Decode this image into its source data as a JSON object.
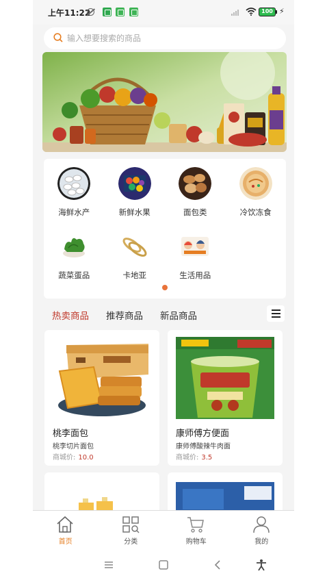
{
  "status_bar": {
    "time": "上午11:22",
    "battery": "100"
  },
  "search": {
    "placeholder": "输入想要搜索的商品",
    "value": ""
  },
  "banner": {
    "icons": [
      "grocery-basket-icon",
      "oil-bottle-icon",
      "noodle-bucket-icon"
    ]
  },
  "categories": [
    {
      "label": "海鲜水产",
      "icon": "dumplings-icon"
    },
    {
      "label": "新鲜水果",
      "icon": "fruit-box-icon"
    },
    {
      "label": "面包类",
      "icon": "bread-icon"
    },
    {
      "label": "冷饮冻食",
      "icon": "frozen-food-icon"
    },
    {
      "label": "蔬菜蛋品",
      "icon": "vegetable-icon"
    },
    {
      "label": "卡地亚",
      "icon": "bracelet-icon"
    },
    {
      "label": "生活用品",
      "icon": "daily-goods-icon"
    }
  ],
  "pager": {
    "pages": 1,
    "active": 0
  },
  "tabs": [
    {
      "label": "热卖商品",
      "active": true
    },
    {
      "label": "推荐商品",
      "active": false
    },
    {
      "label": "新品商品",
      "active": false
    }
  ],
  "products": [
    {
      "name": "桃李面包",
      "desc": "桃李切片面包",
      "price_label": "商城价:",
      "price": "10.0"
    },
    {
      "name": "康师傅方便面",
      "desc": "康师傅酸辣牛肉面",
      "price_label": "商城价:",
      "price": "3.5"
    }
  ],
  "bottom_nav": [
    {
      "label": "首页",
      "icon": "home-icon",
      "active": true
    },
    {
      "label": "分类",
      "icon": "category-grid-icon",
      "active": false
    },
    {
      "label": "购物车",
      "icon": "cart-icon",
      "active": false
    },
    {
      "label": "我的",
      "icon": "user-icon",
      "active": false
    }
  ],
  "colors": {
    "accent": "#e67e22",
    "tab_active": "#c0392b",
    "price": "#c0392b",
    "page_dot": "#e9733a"
  }
}
